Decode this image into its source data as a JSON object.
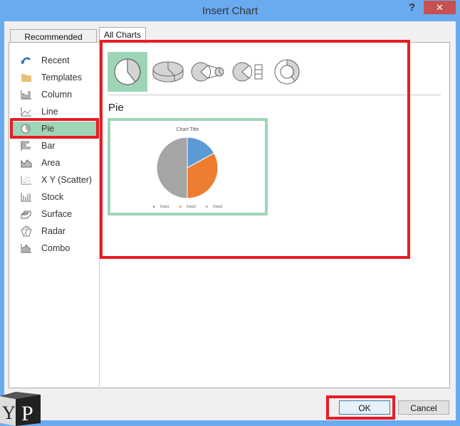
{
  "window": {
    "title": "Insert Chart",
    "help_label": "?",
    "close_label": "✕"
  },
  "tabs": [
    {
      "label": "Recommended Charts",
      "active": false
    },
    {
      "label": "All Charts",
      "active": true
    }
  ],
  "sidebar": {
    "items": [
      {
        "label": "Recent",
        "icon": "recent-icon"
      },
      {
        "label": "Templates",
        "icon": "folder-icon"
      },
      {
        "label": "Column",
        "icon": "column-chart-icon"
      },
      {
        "label": "Line",
        "icon": "line-chart-icon"
      },
      {
        "label": "Pie",
        "icon": "pie-chart-icon",
        "selected": true
      },
      {
        "label": "Bar",
        "icon": "bar-chart-icon"
      },
      {
        "label": "Area",
        "icon": "area-chart-icon"
      },
      {
        "label": "X Y (Scatter)",
        "icon": "scatter-chart-icon"
      },
      {
        "label": "Stock",
        "icon": "stock-chart-icon"
      },
      {
        "label": "Surface",
        "icon": "surface-chart-icon"
      },
      {
        "label": "Radar",
        "icon": "radar-chart-icon"
      },
      {
        "label": "Combo",
        "icon": "combo-chart-icon"
      }
    ]
  },
  "subtypes": [
    {
      "name": "pie",
      "selected": true
    },
    {
      "name": "3d-pie"
    },
    {
      "name": "pie-of-pie"
    },
    {
      "name": "bar-of-pie"
    },
    {
      "name": "doughnut"
    }
  ],
  "selected_type_label": "Pie",
  "preview": {
    "chart_title": "Chart Title",
    "legend": [
      "Data1",
      "Data2",
      "Data3"
    ]
  },
  "chart_data": {
    "type": "pie",
    "title": "Chart Title",
    "categories": [
      "Data1",
      "Data2",
      "Data3"
    ],
    "values": [
      17,
      33,
      50
    ],
    "colors": [
      "#5b9bd5",
      "#ed7d31",
      "#a5a5a5"
    ],
    "legend": "bottom"
  },
  "buttons": {
    "ok": "OK",
    "cancel": "Cancel"
  },
  "colors": {
    "titlebar": "#6aabf0",
    "close": "#c75050",
    "selection": "#9fd5b7",
    "highlight": "#e81c24"
  },
  "watermark": {
    "text_left": "Y",
    "text_right": "P"
  }
}
